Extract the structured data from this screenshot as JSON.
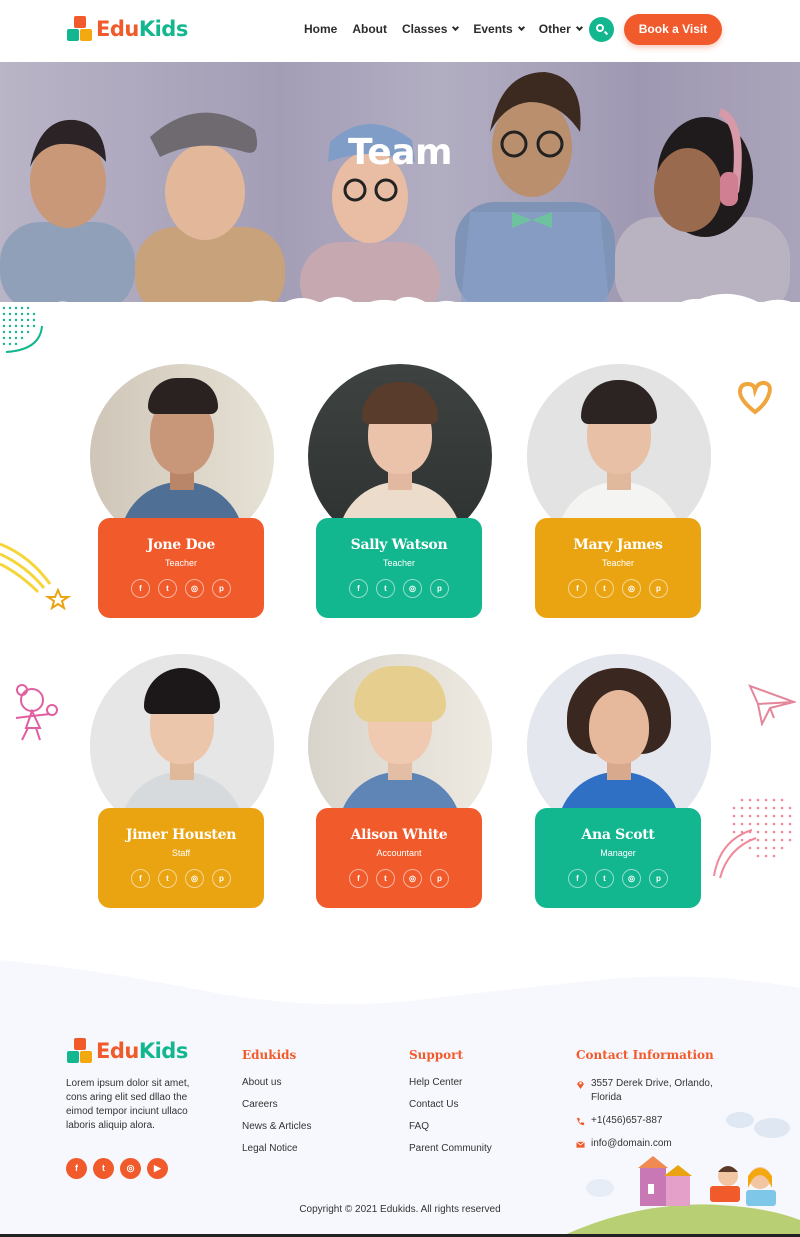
{
  "brand": {
    "part1": "Edu",
    "part2": "Kids"
  },
  "nav": {
    "items": [
      {
        "label": "Home",
        "dropdown": false
      },
      {
        "label": "About",
        "dropdown": false
      },
      {
        "label": "Classes",
        "dropdown": true
      },
      {
        "label": "Events",
        "dropdown": true
      },
      {
        "label": "Other",
        "dropdown": true
      }
    ],
    "search_icon": "search-icon",
    "cta_label": "Book a Visit"
  },
  "hero": {
    "title": "Team"
  },
  "team": [
    {
      "name": "Jone Doe",
      "role": "Teacher",
      "color": "#f15a2b"
    },
    {
      "name": "Sally Watson",
      "role": "Teacher",
      "color": "#12b68f"
    },
    {
      "name": "Mary James",
      "role": "Teacher",
      "color": "#eba411"
    },
    {
      "name": "Jimer Housten",
      "role": "Staff",
      "color": "#eba411"
    },
    {
      "name": "Alison White",
      "role": "Accountant",
      "color": "#f15a2b"
    },
    {
      "name": "Ana Scott",
      "role": "Manager",
      "color": "#12b68f"
    }
  ],
  "social_icons": [
    "facebook-icon",
    "twitter-icon",
    "instagram-icon",
    "pinterest-icon"
  ],
  "footer": {
    "about": "Lorem ipsum dolor sit amet, cons aring elit sed dllao the eimod tempor inciunt ullaco laboris aliquip alora.",
    "social_icons": [
      "facebook-icon",
      "twitter-icon",
      "instagram-icon",
      "youtube-icon"
    ],
    "col1": {
      "title": "Edukids",
      "links": [
        "About us",
        "Careers",
        "News & Articles",
        "Legal Notice"
      ]
    },
    "col2": {
      "title": "Support",
      "links": [
        "Help Center",
        "Contact Us",
        "FAQ",
        "Parent Community"
      ]
    },
    "contact": {
      "title": "Contact Information",
      "address": "3557 Derek Drive, Orlando, Florida",
      "phone": "+1(456)657-887",
      "email": "info@domain.com"
    },
    "copyright": "Copyright © 2021 Edukids. All rights reserved"
  },
  "colors": {
    "orange": "#f15a2b",
    "green": "#12b68f",
    "yellow": "#eba411"
  }
}
